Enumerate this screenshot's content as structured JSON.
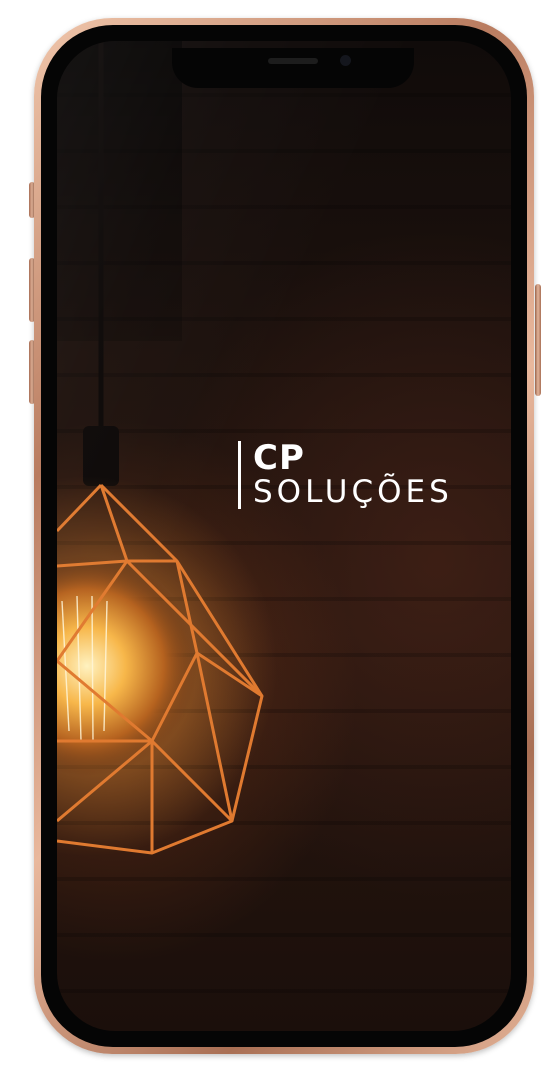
{
  "logo": {
    "line1": "CP",
    "line2": "SOLUÇÕES"
  },
  "colors": {
    "frame": "#d9a488",
    "screen_bg": "#1c110d",
    "lamp_wire": "#e07a30",
    "logo_text": "#ffffff"
  },
  "icons": {
    "camera": "front-camera-icon",
    "speaker": "earpiece-speaker-icon"
  }
}
